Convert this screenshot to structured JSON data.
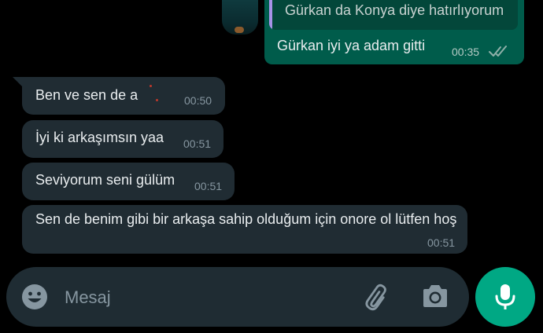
{
  "colors": {
    "background": "#000000",
    "outgoing_bubble": "#005c4b",
    "incoming_bubble": "#202c33",
    "quote_accent": "#a792e8",
    "read_ticks": "#8fb0a9",
    "mic_button": "#00a884",
    "input_bar": "#1f2c33"
  },
  "outgoing_message": {
    "quoted_text": "Gürkan da Konya diye hatırlıyorum",
    "text": "Gürkan iyi ya adam gitti",
    "time": "00:35",
    "status_icon": "double-check-icon"
  },
  "incoming_messages": [
    {
      "text": "Ben ve sen de a",
      "time": "00:50"
    },
    {
      "text": "İyi ki arkaşımsın yaa",
      "time": "00:51"
    },
    {
      "text": "Seviyorum seni gülüm",
      "time": "00:51"
    },
    {
      "text": "Sen de benim gibi bir arkaşa sahip olduğum için onore ol lütfen hoş",
      "time": "00:51"
    }
  ],
  "composer": {
    "placeholder": "Mesaj",
    "emoji_icon": "emoji-icon",
    "attach_icon": "paperclip-icon",
    "camera_icon": "camera-icon",
    "send_icon": "microphone-icon"
  }
}
